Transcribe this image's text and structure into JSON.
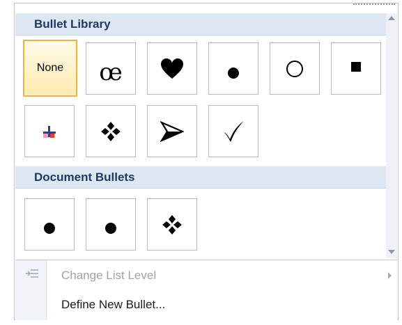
{
  "sections": {
    "bullet_library": {
      "title": "Bullet Library"
    },
    "document_bullets": {
      "title": "Document Bullets"
    }
  },
  "bullet_library": {
    "none_label": "None",
    "tiles": [
      {
        "name": "none",
        "selected": true
      },
      {
        "name": "symbol-oc",
        "glyph": "œ"
      },
      {
        "name": "heart-icon"
      },
      {
        "name": "filled-circle-icon"
      },
      {
        "name": "hollow-circle-icon"
      },
      {
        "name": "filled-square-icon"
      },
      {
        "name": "colored-cross-icon"
      },
      {
        "name": "four-diamond-icon"
      },
      {
        "name": "arrowhead-icon"
      },
      {
        "name": "checkmark-icon"
      }
    ]
  },
  "document_bullets": {
    "tiles": [
      {
        "name": "filled-circle-icon"
      },
      {
        "name": "filled-circle-icon"
      },
      {
        "name": "four-diamond-icon"
      }
    ]
  },
  "menu": {
    "change_list_level": "Change List Level",
    "define_new_bullet": "Define New Bullet..."
  },
  "colors": {
    "header_bg": "#dde7f1",
    "header_text": "#1f3864",
    "selected_border": "#e8b54a"
  }
}
